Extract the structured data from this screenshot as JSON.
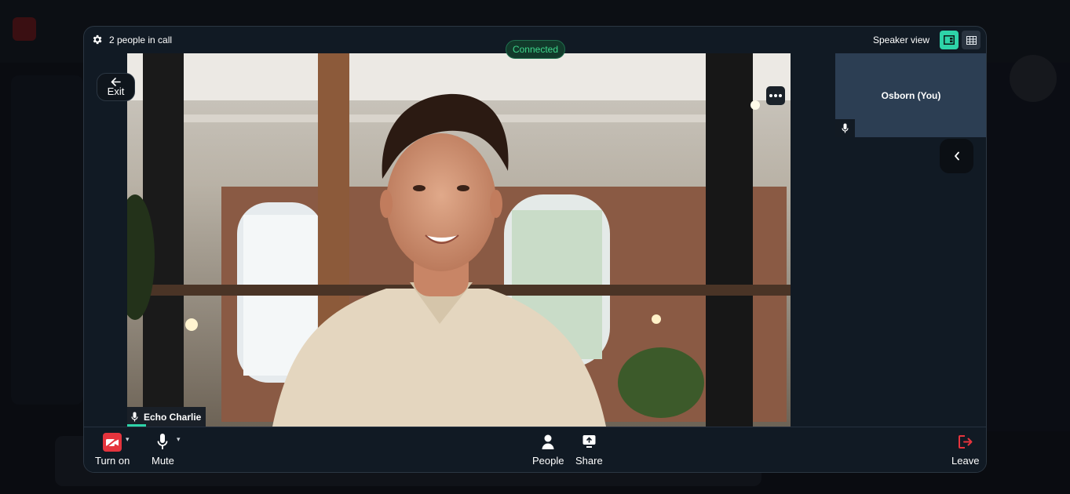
{
  "call": {
    "people_count_label": "2 people in call",
    "status": "Connected",
    "view_label": "Speaker view"
  },
  "stage": {
    "exit_label": "Exit",
    "speaker_name": "Echo Charlie"
  },
  "sidebar": {
    "self_name": "Osborn (You)"
  },
  "controls": {
    "camera_label": "Turn on",
    "mute_label": "Mute",
    "people_label": "People",
    "share_label": "Share",
    "leave_label": "Leave"
  },
  "colors": {
    "accent": "#2ed3a8",
    "connected": "#3fd68c",
    "camera_off": "#e5343d",
    "leave": "#e5343d",
    "modal_bg": "#111a24",
    "self_tile": "#2c3e53"
  },
  "icons": [
    "gear-icon",
    "speaker-view-icon",
    "grid-view-icon",
    "arrow-left-icon",
    "more-dots-icon",
    "microphone-icon",
    "chevron-left-icon",
    "camera-off-icon",
    "chevron-down-icon",
    "person-icon",
    "share-screen-icon",
    "leave-icon"
  ]
}
